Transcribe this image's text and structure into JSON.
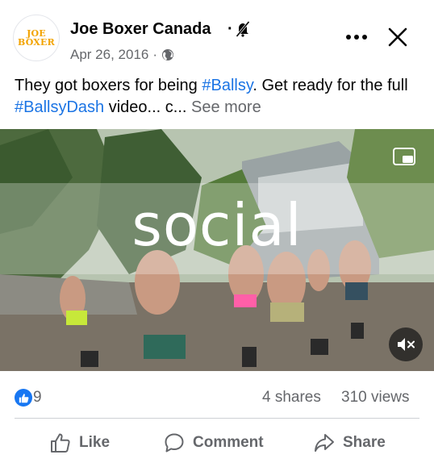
{
  "post": {
    "author": "Joe Boxer Canada",
    "date": "Apr 26, 2016",
    "meta_separator": "·",
    "header_separator": "·",
    "avatar": {
      "line1": "JOE",
      "line2": "BOXER"
    },
    "text_before": "They got boxers for being ",
    "hashtag1": "#Ballsy",
    "text_middle": ". Get ready for the full ",
    "hashtag2": "#BallsyDash",
    "text_after": " video... c... ",
    "see_more": "See more"
  },
  "video": {
    "caption": "social",
    "icons": {
      "mute": "volume-muted-icon",
      "pip": "picture-in-picture-icon"
    }
  },
  "stats": {
    "likes": "9",
    "shares": "4 shares",
    "views": "310 views"
  },
  "actions": {
    "like": "Like",
    "comment": "Comment",
    "share": "Share"
  },
  "colors": {
    "accent": "#1877f2",
    "hashtag": "#1b74e4",
    "secondary_text": "#65676b",
    "brand_logo": "#f2a300"
  }
}
